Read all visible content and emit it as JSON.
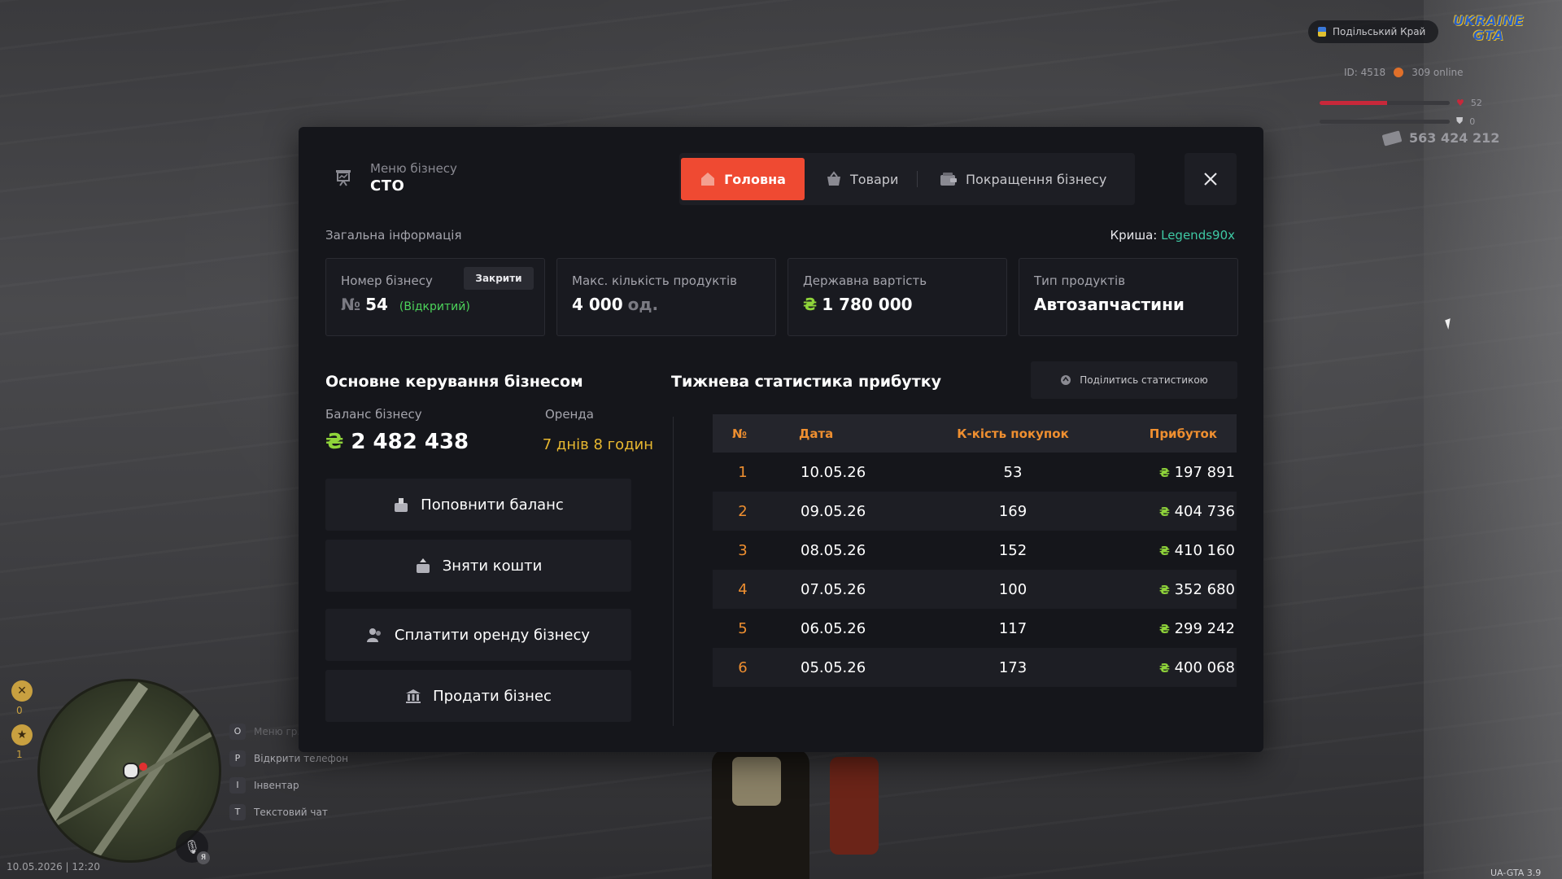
{
  "hud": {
    "server_name": "Подільський Край",
    "logo_line1": "UKRAINE",
    "logo_line2": "GTA",
    "player_id": "ID: 4518",
    "online": "309 online",
    "health": 52,
    "armor": 0,
    "money": "563 424 212",
    "side_counter_1": "0",
    "side_counter_2": "1",
    "keys": [
      {
        "key": "O",
        "label": "Меню гр..."
      },
      {
        "key": "P",
        "label": "Відкрити телефон"
      },
      {
        "key": "I",
        "label": "Інвентар"
      },
      {
        "key": "T",
        "label": "Текстовий чат"
      }
    ],
    "mic_badge": "Я",
    "datetime": "10.05.2026 | 12:20",
    "version": "UA-GTA 3.9"
  },
  "modal": {
    "menu_label": "Меню бізнесу",
    "menu_title": "СТО",
    "tabs": [
      {
        "label": "Головна",
        "active": true
      },
      {
        "label": "Товари",
        "active": false
      },
      {
        "label": "Покращення бізнесу",
        "active": false
      }
    ],
    "general_title": "Загальна інформація",
    "roof_label": "Криша:",
    "roof_owner": "Legends90x",
    "cards": {
      "number_label": "Номер бізнесу",
      "number_prefix": "№",
      "number_value": "54",
      "number_status": "(Відкритий)",
      "close_button": "Закрити",
      "max_label": "Макс. кількість продуктів",
      "max_value": "4 000",
      "max_unit": "од.",
      "state_label": "Державна вартість",
      "currency": "₴",
      "state_value": "1 780 000",
      "type_label": "Тип продуктів",
      "type_value": "Автозапчастини"
    },
    "manage_title": "Основне керування бізнесом",
    "balance_label": "Баланс бізнесу",
    "balance_value": "2 482 438",
    "rent_label": "Оренда",
    "rent_value": "7 днів 8 годин",
    "actions": {
      "topup": "Поповнити баланс",
      "withdraw": "Зняти кошти",
      "pay_rent": "Сплатити оренду бізнесу",
      "sell": "Продати бізнес"
    },
    "weekly_title": "Тижнева статистика прибутку",
    "share_button": "Поділитись статистикою",
    "table": {
      "headers": [
        "№",
        "Дата",
        "К-кість покупок",
        "Прибуток"
      ],
      "rows": [
        {
          "n": "1",
          "date": "10.05.26",
          "count": "53",
          "profit": "197 891"
        },
        {
          "n": "2",
          "date": "09.05.26",
          "count": "169",
          "profit": "404 736"
        },
        {
          "n": "3",
          "date": "08.05.26",
          "count": "152",
          "profit": "410 160"
        },
        {
          "n": "4",
          "date": "07.05.26",
          "count": "100",
          "profit": "352 680"
        },
        {
          "n": "5",
          "date": "06.05.26",
          "count": "117",
          "profit": "299 242"
        },
        {
          "n": "6",
          "date": "05.05.26",
          "count": "173",
          "profit": "400 068"
        }
      ]
    }
  }
}
